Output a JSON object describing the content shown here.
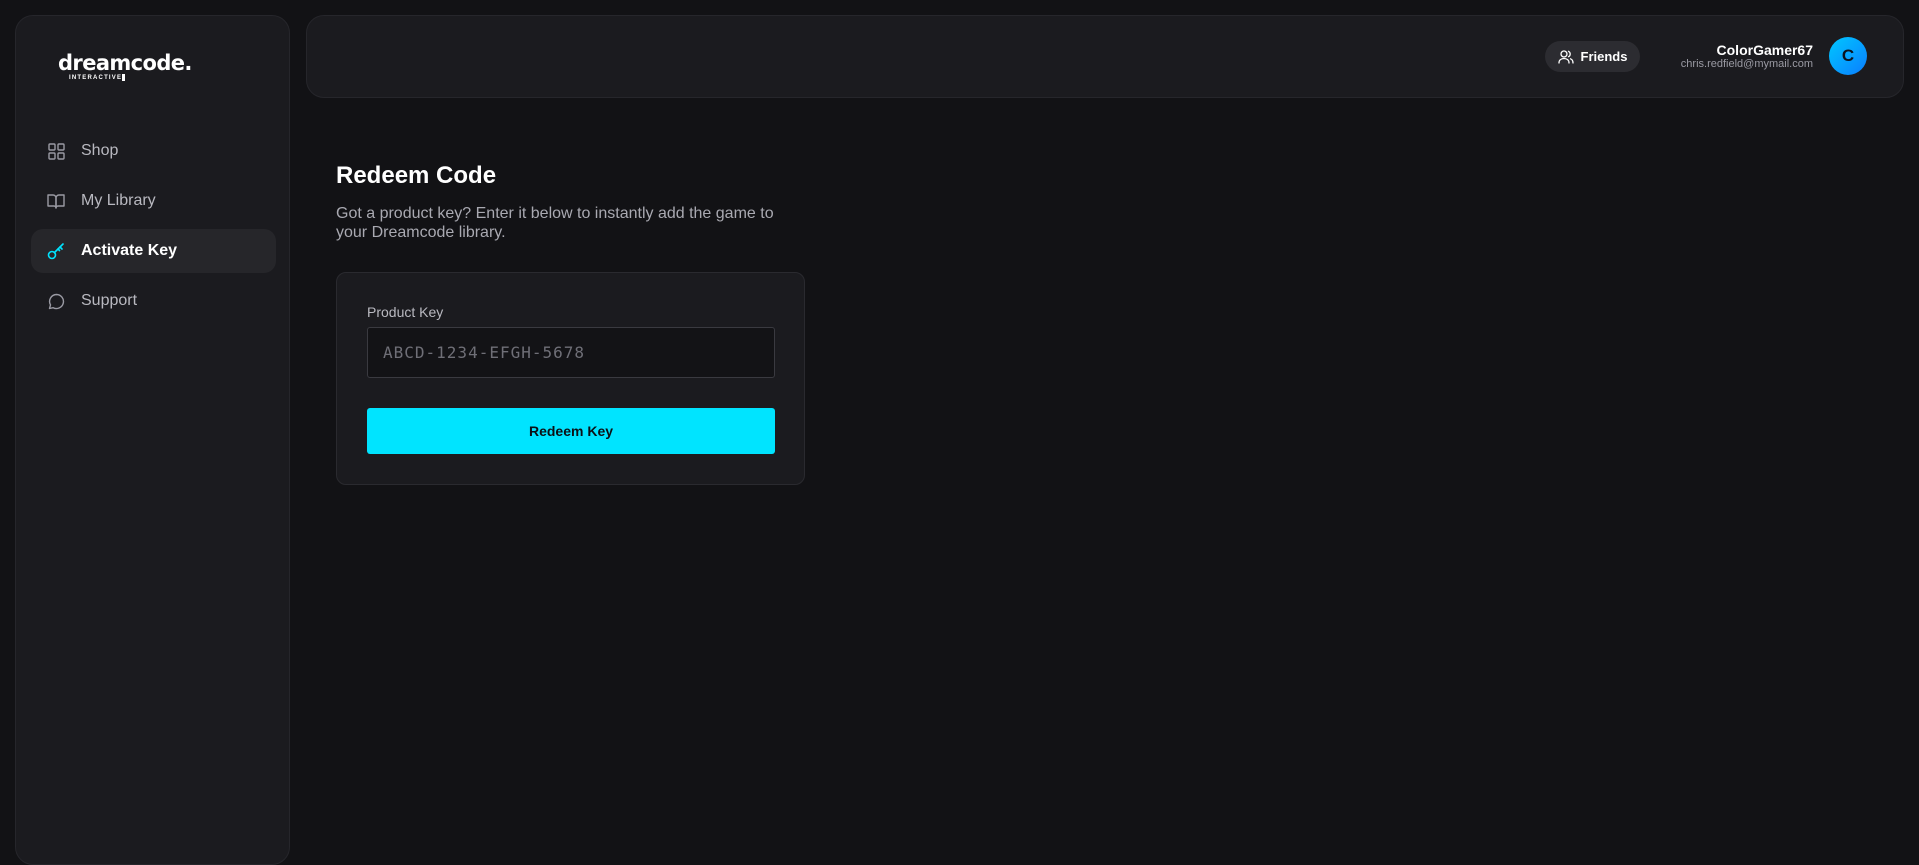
{
  "brand": {
    "name": "dreamcode.",
    "tagline": "INTERACTIVE"
  },
  "sidebar": {
    "items": [
      {
        "label": "Shop",
        "icon": "grid-icon",
        "active": false
      },
      {
        "label": "My Library",
        "icon": "book-icon",
        "active": false
      },
      {
        "label": "Activate Key",
        "icon": "key-icon",
        "active": true
      },
      {
        "label": "Support",
        "icon": "chat-bubble-icon",
        "active": false
      }
    ]
  },
  "header": {
    "friends_label": "Friends",
    "user": {
      "name": "ColorGamer67",
      "email": "chris.redfield@mymail.com",
      "avatar_initial": "C"
    }
  },
  "main": {
    "title": "Redeem Code",
    "description": "Got a product key? Enter it below to instantly add the game to your Dreamcode library.",
    "form": {
      "field_label": "Product Key",
      "placeholder": "ABCD-1234-EFGH-5678",
      "value": "",
      "submit_label": "Redeem Key"
    }
  },
  "colors": {
    "accent": "#00e4ff",
    "background": "#121215",
    "panel": "#1b1b1f"
  }
}
